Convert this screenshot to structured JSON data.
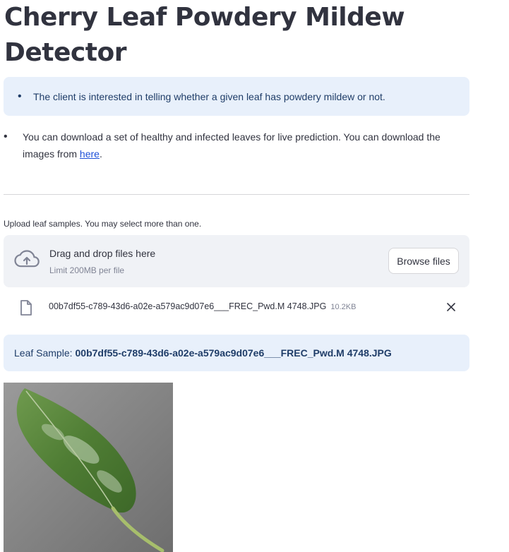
{
  "title": "Cherry Leaf Powdery Mildew Detector",
  "info_text": "The client is interested in telling whether a given leaf has powdery mildew or not.",
  "bullet": {
    "text": "You can download a set of healthy and infected leaves for live prediction. You can download the images from ",
    "link": "here",
    "suffix": "."
  },
  "uploader": {
    "label": "Upload leaf samples. You may select more than one.",
    "drag_text": "Drag and drop files here",
    "limit_text": "Limit 200MB per file",
    "browse_label": "Browse files"
  },
  "uploaded_file": {
    "name": "00b7df55-c789-43d6-a02e-a579ac9d07e6___FREC_Pwd.M 4748.JPG",
    "size": "10.2KB"
  },
  "sample": {
    "label": "Leaf Sample:",
    "filename": "00b7df55-c789-43d6-a02e-a579ac9d07e6___FREC_Pwd.M 4748.JPG"
  },
  "colors": {
    "info_bg": "#e8f0fb",
    "info_text": "#1f3d68",
    "link": "#1c4fd8"
  },
  "icons": {
    "upload": "cloud-upload-icon",
    "file": "file-icon",
    "close": "close-icon"
  }
}
